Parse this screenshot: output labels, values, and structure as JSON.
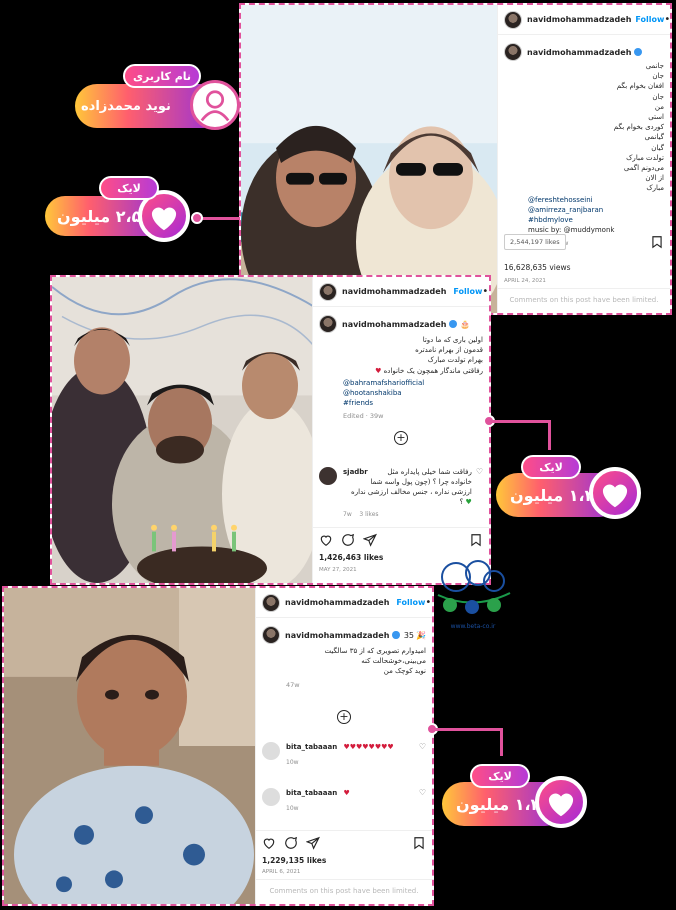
{
  "username_badge": {
    "tab": "نام کاربری",
    "name": "نوید محمدزاده"
  },
  "badges": [
    {
      "tab": "لایک",
      "value": "۲،۵۴ میلیون"
    },
    {
      "tab": "لایک",
      "value": "۱،۴ میلیون"
    },
    {
      "tab": "لایک",
      "value": "۱،۲ میلیون"
    }
  ],
  "post1": {
    "username": "navidmohammadzadeh",
    "follow": "Follow",
    "caption_lines": [
      "جانمی",
      "جان",
      "افغان بخوام بگم",
      "جان",
      "من",
      "استی",
      "کوردی بخوام بگم",
      "گیانمی",
      "گیان",
      "تولدت مبارک",
      "می‌دونم اگمی",
      "از الان",
      "مبارک"
    ],
    "mentions": [
      "@fereshtehosseini",
      "@amirreza_ranjbaran",
      "#hbdmylove",
      "music by: @muddymonk"
    ],
    "edited": "Edited · 44w",
    "tooltip": "2,544,197 likes",
    "views": "16,628,635 views",
    "date": "APRIL 24, 2021",
    "limited": "Comments on this post have been limited."
  },
  "post2": {
    "username": "navidmohammadzadeh",
    "follow": "Follow",
    "caption_lines": [
      "اولین باری که ما دوتا",
      "قدمون از بهرام نامدتره",
      "بهرام تولدت مبارک",
      "رفاقتی ماندگار همچون یک خانواده"
    ],
    "mentions": [
      "@bahramafshariofficial",
      "@hootanshakiba",
      "#friends"
    ],
    "edited": "Edited · 39w",
    "comment_user": "sjadbr",
    "comment_lines": [
      "رفاقت شما خیلی پایداره مثل",
      "خانواده چرا ؟ (چون پول واسه شما",
      "ارزشی نداره ، جنس مخالف ارزشی نداره",
      "؟"
    ],
    "comment_meta": "7w",
    "comment_likes": "3 likes",
    "likes": "1,426,463 likes",
    "date": "MAY 27, 2021"
  },
  "post3": {
    "username": "navidmohammadzadeh",
    "follow": "Follow",
    "caption_suffix": "35",
    "caption_lines": [
      "امیدوارم تصویری که از ۳۵ سالگیت",
      "می‌بینی،خوشحالت کنه",
      "نوید کوچک من"
    ],
    "edited": "47w",
    "c1_user": "bita_tabaaan",
    "c1_meta": "10w",
    "c2_user": "bita_tabaaan",
    "c2_meta": "10w",
    "likes": "1,229,135 likes",
    "date": "APRIL 6, 2021",
    "limited": "Comments on this post have been limited."
  },
  "watermark": {
    "text": "www.beta-co.ir"
  }
}
